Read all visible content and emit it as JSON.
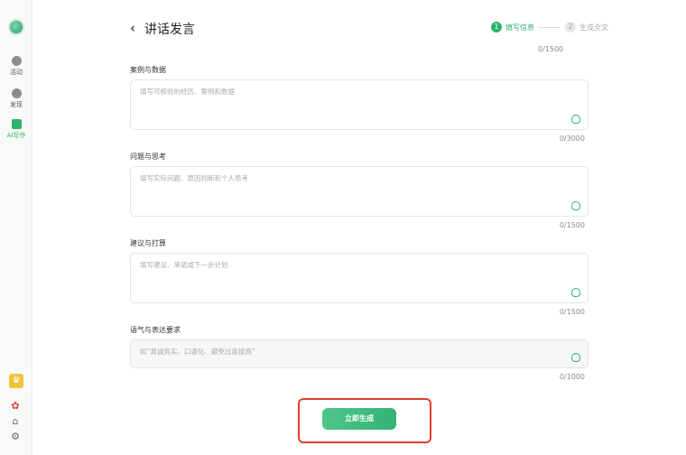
{
  "window": {
    "minimize": "—",
    "maximize": "□",
    "close": "✕"
  },
  "sidebar": {
    "items": [
      {
        "label": "活动",
        "icon": "home-icon"
      },
      {
        "label": "发现",
        "icon": "compass-icon"
      },
      {
        "label": "AI写作",
        "icon": "ai-write-icon"
      }
    ]
  },
  "header": {
    "back_icon": "‹",
    "title": "讲话发言"
  },
  "steps": [
    {
      "num": "1",
      "label": "填写信息"
    },
    {
      "num": "2",
      "label": "生成全文"
    }
  ],
  "top_counter": "0/1500",
  "fields": [
    {
      "label": "案例与数据",
      "placeholder": "填写可核验的经历、案例和数据",
      "counter": "0/3000"
    },
    {
      "label": "问题与思考",
      "placeholder": "填写实际问题、原因判断和个人思考",
      "counter": "0/1500"
    },
    {
      "label": "建议与打算",
      "placeholder": "填写建议、承诺或下一步计划",
      "counter": "0/1500"
    },
    {
      "label": "语气与表达要求",
      "placeholder": "如“真诚务实、口语化、避免过度拔高”",
      "counter": "0/1000"
    }
  ],
  "generate_button": "立即生成",
  "colors": {
    "accent": "#2fb36d",
    "highlight": "#e0402c"
  }
}
